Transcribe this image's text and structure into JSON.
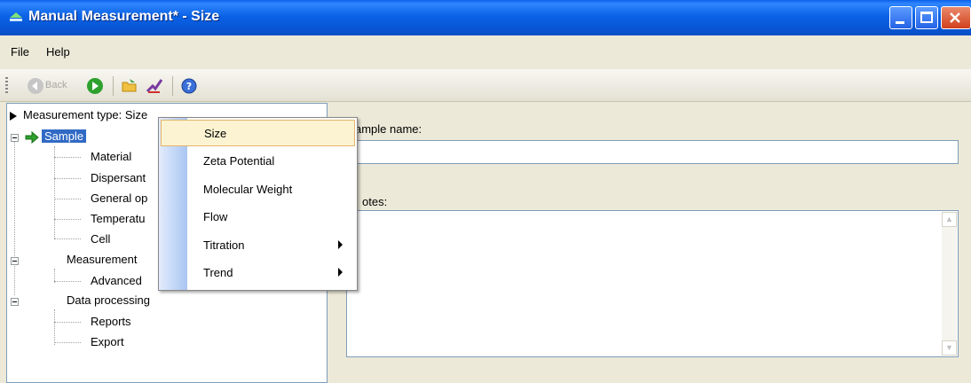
{
  "window": {
    "title": "Manual Measurement* - Size"
  },
  "menubar": {
    "items": [
      "File",
      "Help"
    ]
  },
  "toolbar": {
    "back_label": "Back",
    "icons": [
      "back-icon",
      "forward-icon",
      "open-folder-icon",
      "edit-check-icon",
      "help-icon"
    ]
  },
  "tree": {
    "items": [
      {
        "label": "Measurement type: Size"
      },
      {
        "label": "Sample"
      },
      {
        "label": "Material"
      },
      {
        "label": "Dispersant"
      },
      {
        "label": "General op"
      },
      {
        "label": "Temperatu"
      },
      {
        "label": "Cell"
      },
      {
        "label": "Measurement"
      },
      {
        "label": "Advanced"
      },
      {
        "label": "Data processing"
      },
      {
        "label": "Reports"
      },
      {
        "label": "Export"
      }
    ]
  },
  "right_panel": {
    "sample_name_label": "ample name:",
    "sample_name_value": "",
    "notes_label": "otes:",
    "notes_value": ""
  },
  "context_menu": {
    "items": [
      {
        "label": "Size",
        "submenu": false
      },
      {
        "label": "Zeta Potential",
        "submenu": false
      },
      {
        "label": "Molecular Weight",
        "submenu": false
      },
      {
        "label": "Flow",
        "submenu": false
      },
      {
        "label": "Titration",
        "submenu": true
      },
      {
        "label": "Trend",
        "submenu": true
      }
    ]
  },
  "colors": {
    "titlebar": "#0a5fe8",
    "selection": "#316ac5",
    "menu_hover": "#fbf3d1"
  }
}
